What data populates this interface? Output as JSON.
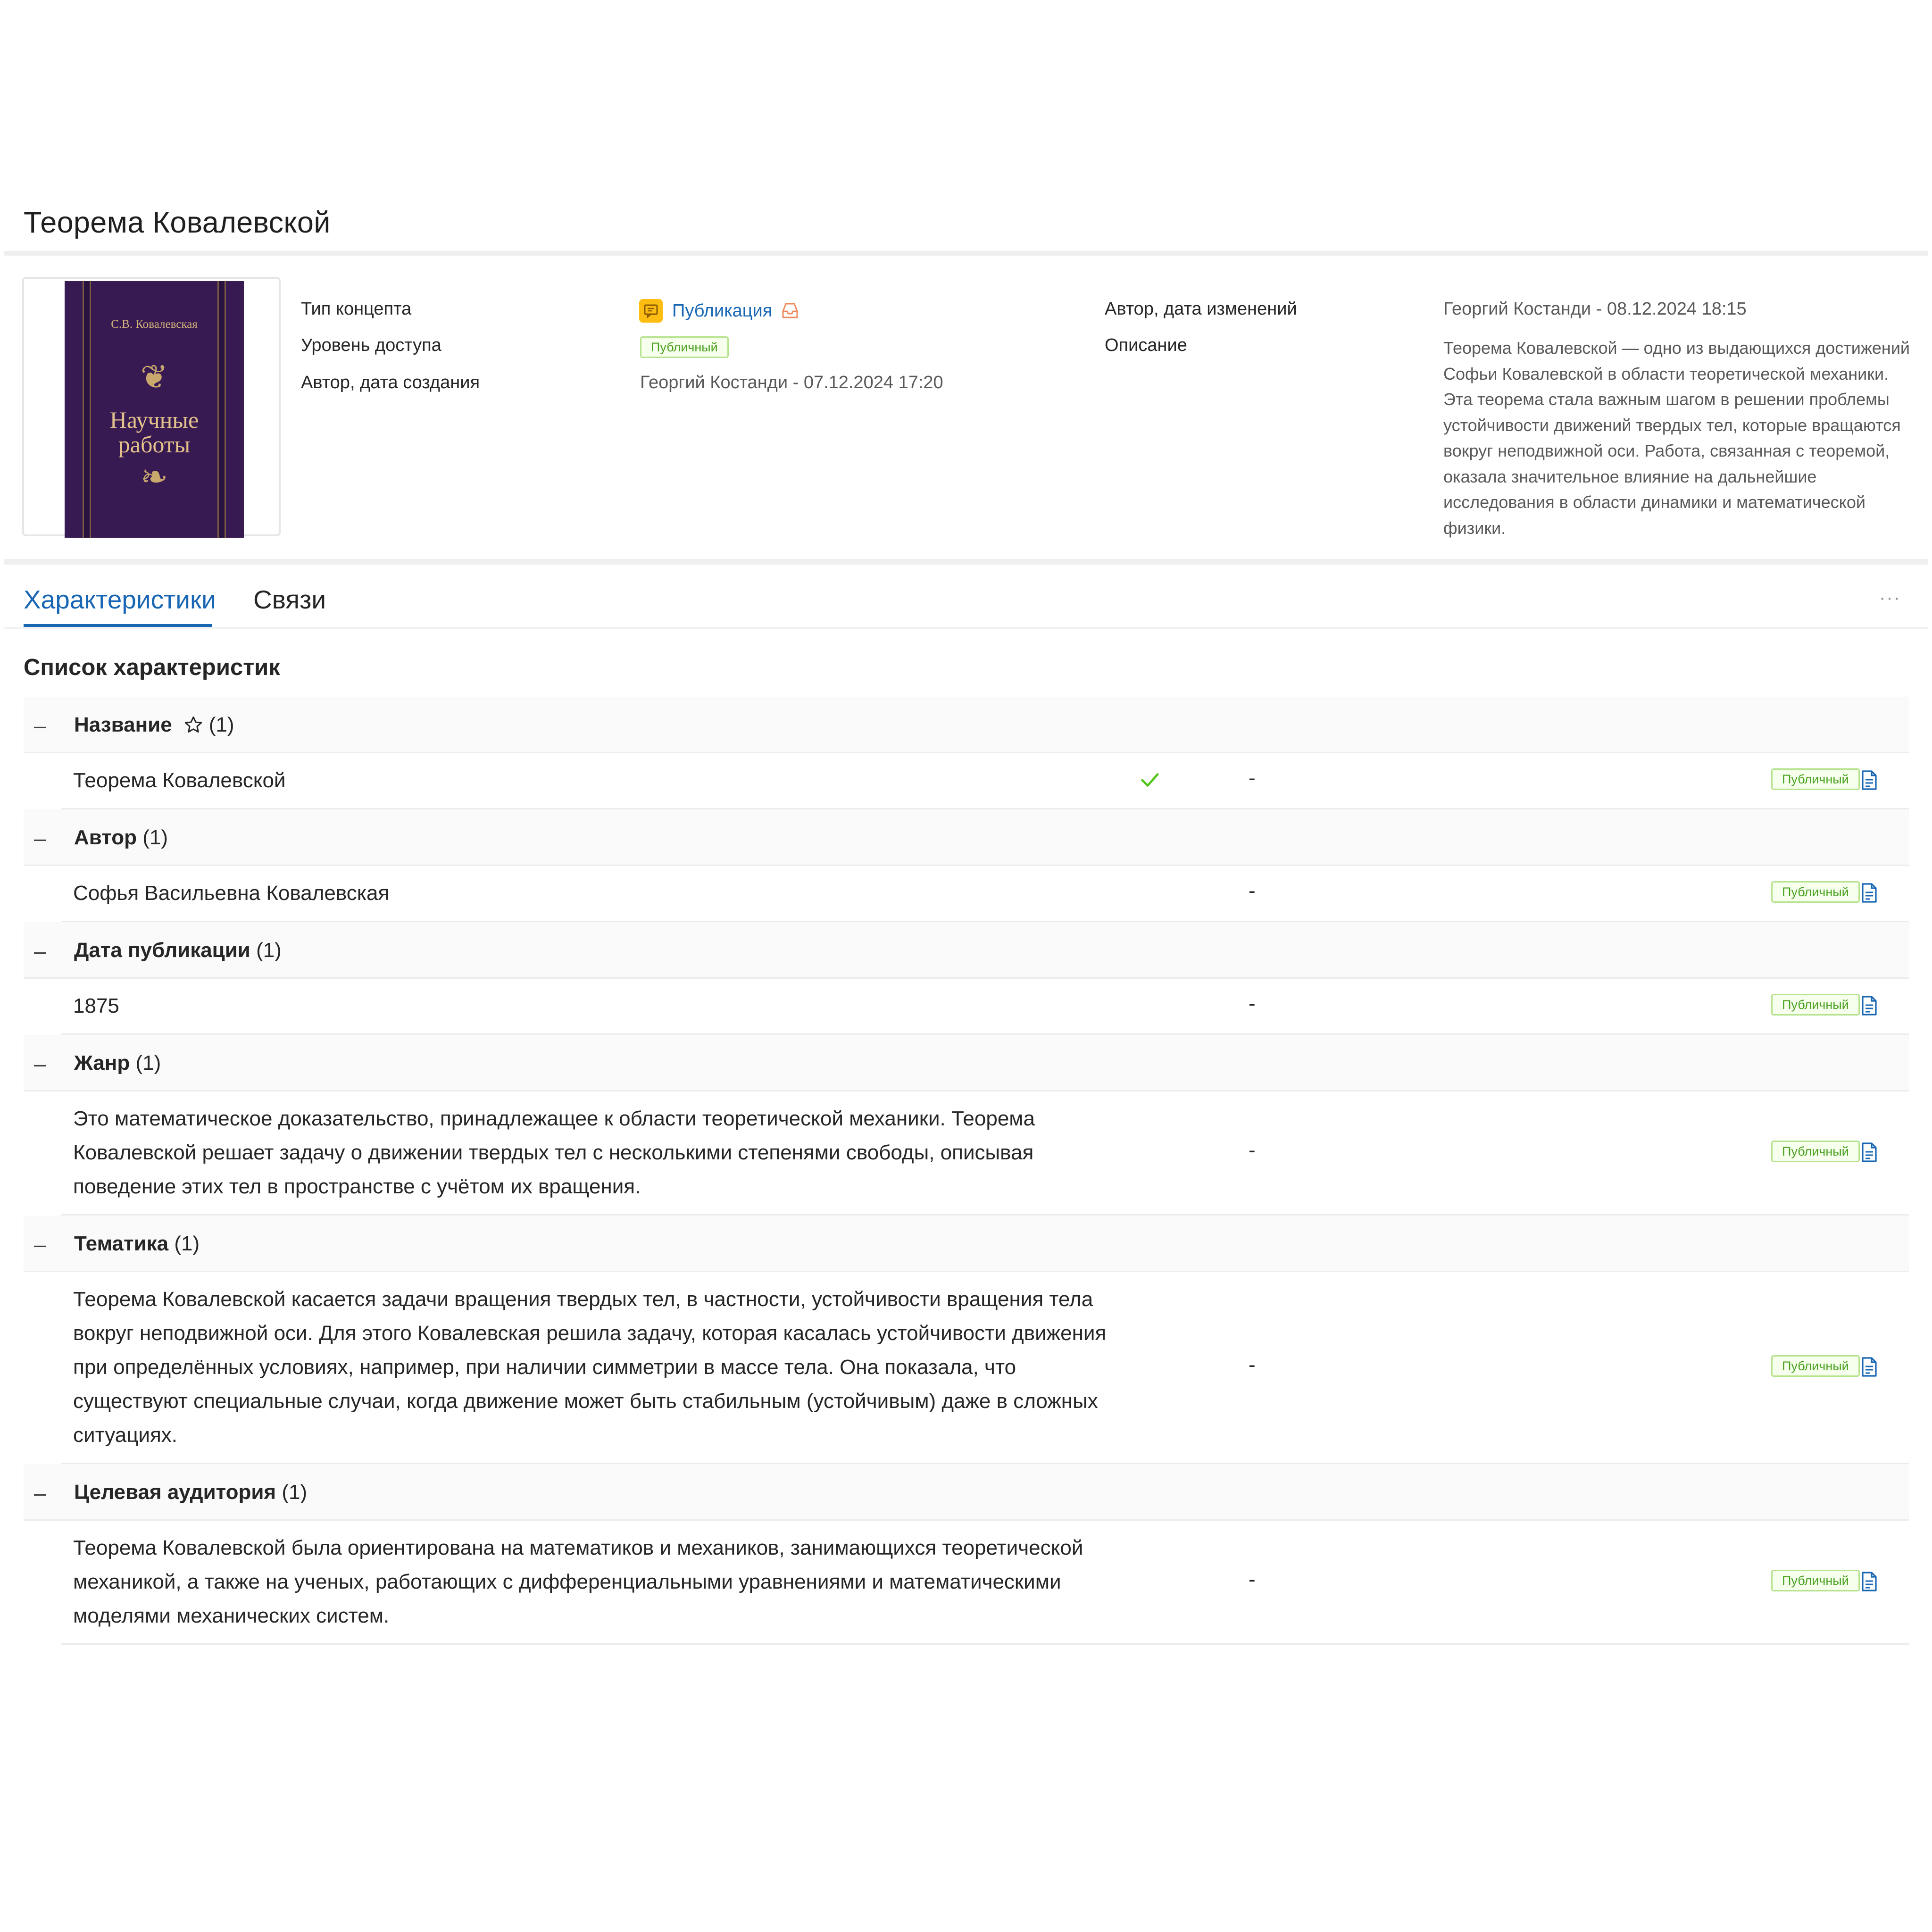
{
  "page": {
    "title": "Теорема Ковалевской"
  },
  "cover": {
    "author": "С.В. Ковалевская",
    "title_line1": "Научные",
    "title_line2": "работы"
  },
  "meta": {
    "concept_type_label": "Тип концепта",
    "concept_type_value": "Публикация",
    "access_level_label": "Уровень доступа",
    "access_level_value": "Публичный",
    "created_label": "Автор, дата создания",
    "created_value": "Георгий  Костанди - 07.12.2024 17:20",
    "modified_label": "Автор, дата изменений",
    "modified_value": "Георгий  Костанди - 08.12.2024 18:15",
    "description_label": "Описание",
    "description_value": "Теорема Ковалевской — одно из выдающихся достижений Софьи Ковалевской в области теоретической механики. Эта теорема стала важным шагом в решении проблемы устойчивости движений твердых тел, которые вращаются вокруг неподвижной оси. Работа, связанная с теоремой, оказала значительное влияние на дальнейшие исследования в области динамики и математической физики."
  },
  "tabs": [
    {
      "label": "Характеристики",
      "active": true
    },
    {
      "label": "Связи",
      "active": false
    }
  ],
  "more_label": "···",
  "section_title": "Список характеристик",
  "collapse_symbol": "–",
  "groups": [
    {
      "name": "Название",
      "count": "(1)",
      "starred": true,
      "rows": [
        {
          "value": "Теорема Ковалевской",
          "verified": true,
          "dash": "-",
          "access": "Публичный"
        }
      ]
    },
    {
      "name": "Автор",
      "count": "(1)",
      "starred": false,
      "rows": [
        {
          "value": "Софья Васильевна Ковалевская",
          "verified": false,
          "dash": "-",
          "access": "Публичный"
        }
      ]
    },
    {
      "name": "Дата публикации",
      "count": "(1)",
      "starred": false,
      "rows": [
        {
          "value": "1875",
          "verified": false,
          "dash": "-",
          "access": "Публичный"
        }
      ]
    },
    {
      "name": "Жанр",
      "count": "(1)",
      "starred": false,
      "rows": [
        {
          "value": "Это математическое доказательство, принадлежащее к области теоретической механики. Теорема Ковалевской решает задачу о движении твердых тел с несколькими степенями свободы, описывая поведение этих тел в пространстве с учётом их вращения.",
          "verified": false,
          "dash": "-",
          "access": "Публичный"
        }
      ]
    },
    {
      "name": "Тематика",
      "count": "(1)",
      "starred": false,
      "rows": [
        {
          "value": "Теорема Ковалевской касается задачи вращения твердых тел, в частности, устойчивости вращения тела вокруг неподвижной оси. Для этого Ковалевская решила задачу, которая касалась устойчивости движения при определённых условиях, например, при наличии симметрии в массе тела. Она показала, что существуют специальные случаи, когда движение может быть стабильным (устойчивым) даже в сложных ситуациях.",
          "verified": false,
          "dash": "-",
          "access": "Публичный"
        }
      ]
    },
    {
      "name": "Целевая аудитория",
      "count": "(1)",
      "starred": false,
      "rows": [
        {
          "value": "Теорема Ковалевской была ориентирована на математиков и механиков, занимающихся теоретической механикой, а также на ученых, работающих с дифференциальными уравнениями и математическими моделями механических систем.",
          "verified": false,
          "dash": "-",
          "access": "Публичный"
        }
      ]
    }
  ],
  "colors": {
    "accent": "#1967b4",
    "concept_icon": "#fdbd12",
    "public_tag_text": "#49a01f",
    "public_tag_border": "#b6e38d",
    "check": "#52c41a",
    "cover": "#381a52"
  },
  "icons": {
    "concept": "publication-icon",
    "inbox": "inbox-icon",
    "star": "star-outline-icon",
    "check": "check-icon",
    "doc": "document-icon"
  }
}
